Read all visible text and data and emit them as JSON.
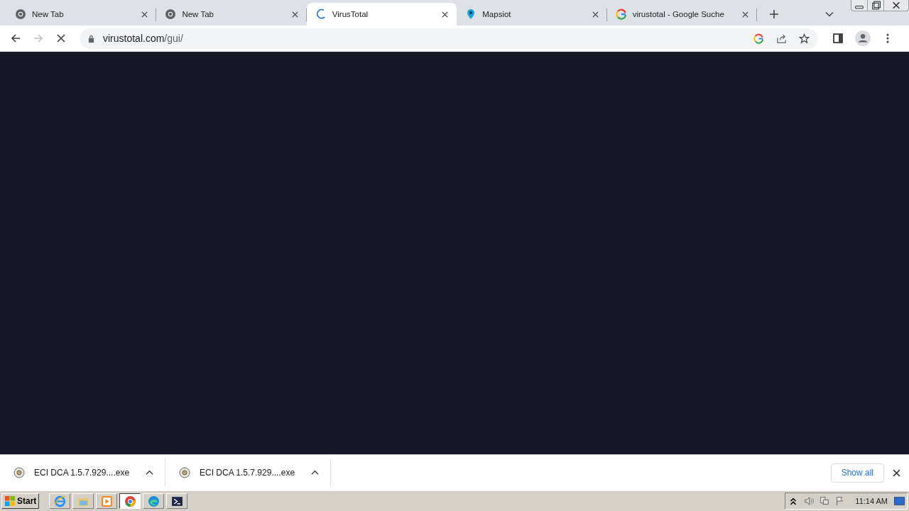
{
  "tabs": [
    {
      "title": "New Tab",
      "kind": "chrome",
      "selected": false
    },
    {
      "title": "New Tab",
      "kind": "chrome",
      "selected": false
    },
    {
      "title": "VirusTotal",
      "kind": "spinner",
      "selected": true
    },
    {
      "title": "Mapsiot",
      "kind": "pin",
      "selected": false
    },
    {
      "title": "virustotal - Google Suche",
      "kind": "google",
      "selected": false
    }
  ],
  "toolbar": {
    "url_host": "virustotal.com",
    "url_path": "/gui/",
    "loading": true
  },
  "downloads": [
    {
      "filename": "ECI DCA 1.5.7.929....exe"
    },
    {
      "filename": "ECI DCA 1.5.7.929....exe"
    }
  ],
  "show_all": "Show all",
  "taskbar": {
    "start": "Start",
    "apps": [
      {
        "kind": "ie",
        "selected": false
      },
      {
        "kind": "explorer",
        "selected": false
      },
      {
        "kind": "media",
        "selected": false
      },
      {
        "kind": "chrome",
        "selected": true
      },
      {
        "kind": "edge",
        "selected": false
      },
      {
        "kind": "terminal",
        "selected": false
      }
    ],
    "clock": "11:14 AM"
  }
}
